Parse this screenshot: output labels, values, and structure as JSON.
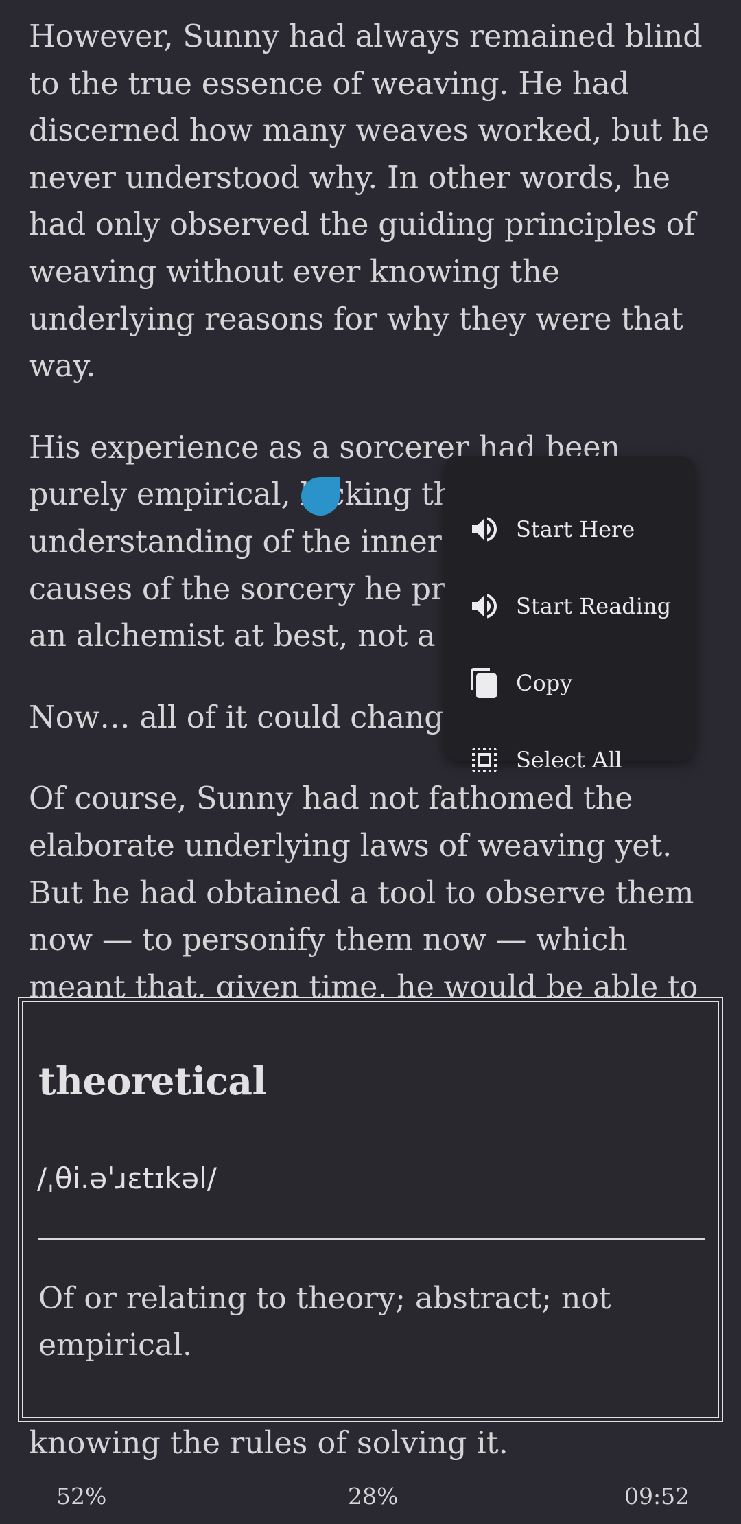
{
  "reader": {
    "paragraphs": [
      "However, Sunny had always remained blind to the true essence of weaving. He had discerned how many weaves worked, but he never understood why. In other words, he had only observed the guiding principles of weaving without ever knowing the underlying reasons for why they were that way.",
      "Now… all of it could change.",
      "Of course, Sunny had not fathomed the elaborate underlying laws of weaving yet. But he had obtained a tool to observe them now — to personify them now — which meant that, given time, he would be able to comprehend and learn them. When he did..."
    ],
    "para2_before": "His experience as a sorcerer had been purely empirical, lacking the ",
    "selected_word": "theoretical",
    "para2_after": " understanding of the inner workings and causes of the sorcery he practiced. He was an alchemist at best, not a chemist.",
    "bottom_line": "knowing the rules of solving it."
  },
  "context_menu": {
    "items": [
      {
        "label": "Start Here",
        "icon": "speaker-icon"
      },
      {
        "label": "Start Reading",
        "icon": "speaker-icon"
      },
      {
        "label": "Copy",
        "icon": "copy-icon"
      },
      {
        "label": "Select All",
        "icon": "select-all-icon"
      }
    ]
  },
  "dictionary": {
    "word": "theoretical",
    "pronunciation": "/ˌθi.əˈɹɛtɪkəl/",
    "definition": "Of or relating to theory; abstract; not empirical."
  },
  "status_bar": {
    "battery": "52%",
    "progress": "28%",
    "time": "09:52"
  },
  "colors": {
    "background": "#2a2931",
    "text": "#d6d4d6",
    "selection": "#b9c0dd",
    "handle": "#2b93c9",
    "menu": "#212024"
  }
}
